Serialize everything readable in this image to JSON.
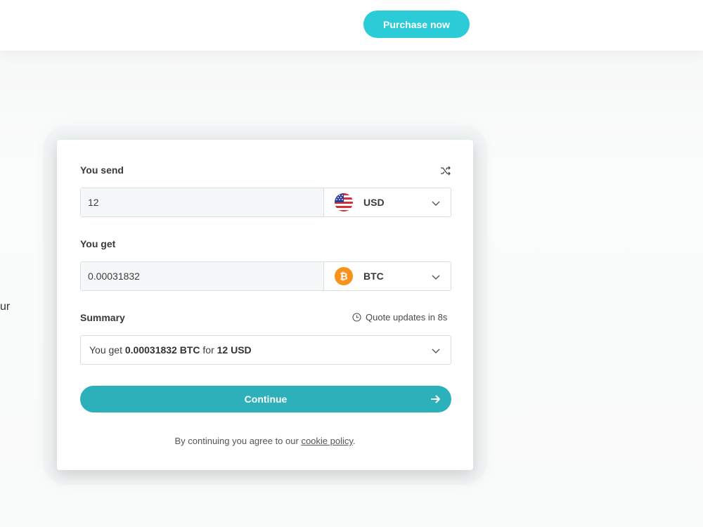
{
  "header": {
    "purchase_button": "Purchase now"
  },
  "background": {
    "partial_text": "ur"
  },
  "widget": {
    "send": {
      "label": "You send",
      "amount": "12",
      "currency": "USD",
      "currency_icon": "us-flag-icon"
    },
    "get": {
      "label": "You get",
      "amount": "0.00031832",
      "currency": "BTC",
      "currency_icon": "bitcoin-icon"
    },
    "summary": {
      "label": "Summary",
      "quote_text": "Quote updates in 8s",
      "prefix": "You get",
      "get_value": "0.00031832 BTC",
      "connector": "for",
      "send_value": "12 USD"
    },
    "continue_button": "Continue",
    "footnote": {
      "text": "By continuing you agree to our",
      "link": "cookie policy",
      "suffix": "."
    }
  },
  "colors": {
    "accent": "#2cb0ba",
    "purchase_button": "#2ccbd8",
    "bitcoin": "#f7931a"
  }
}
